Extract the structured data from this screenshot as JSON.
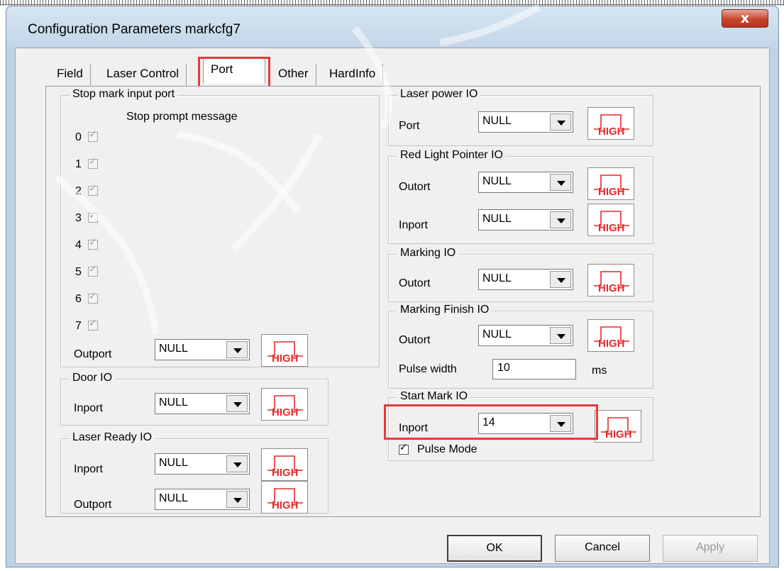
{
  "window": {
    "title": "Configuration Parameters markcfg7",
    "close_glyph": "x"
  },
  "tabs": [
    {
      "label": "Field",
      "active": false
    },
    {
      "label": "Laser Control",
      "active": false
    },
    {
      "label": "Port",
      "active": true
    },
    {
      "label": "Other",
      "active": false
    },
    {
      "label": "HardInfo",
      "active": false
    }
  ],
  "stop_mark": {
    "legend": "Stop mark input port",
    "caption": "Stop prompt message",
    "inputs": [
      {
        "index": "0",
        "checked": true
      },
      {
        "index": "1",
        "checked": true
      },
      {
        "index": "2",
        "checked": true
      },
      {
        "index": "3",
        "checked": true
      },
      {
        "index": "4",
        "checked": true
      },
      {
        "index": "5",
        "checked": true
      },
      {
        "index": "6",
        "checked": true
      },
      {
        "index": "7",
        "checked": true
      }
    ],
    "outport_label": "Outport",
    "outport_value": "NULL"
  },
  "door_io": {
    "legend": "Door IO",
    "inport_label": "Inport",
    "inport_value": "NULL"
  },
  "laser_ready_io": {
    "legend": "Laser Ready IO",
    "inport_label": "Inport",
    "inport_value": "NULL",
    "outport_label": "Outport",
    "outport_value": "NULL"
  },
  "laser_power_io": {
    "legend": "Laser power IO",
    "port_label": "Port",
    "port_value": "NULL"
  },
  "red_light_io": {
    "legend": "Red Light Pointer IO",
    "outport_label": "Outort",
    "outport_value": "NULL",
    "inport_label": "Inport",
    "inport_value": "NULL"
  },
  "marking_io": {
    "legend": "Marking IO",
    "outport_label": "Outort",
    "outport_value": "NULL"
  },
  "marking_finish_io": {
    "legend": "Marking Finish IO",
    "outport_label": "Outort",
    "outport_value": "NULL",
    "pulse_width_label": "Pulse width",
    "pulse_width_value": "10",
    "pulse_width_unit": "ms"
  },
  "start_mark_io": {
    "legend": "Start Mark IO",
    "inport_label": "Inport",
    "inport_value": "14",
    "pulse_mode_label": "Pulse Mode",
    "pulse_mode_checked": true
  },
  "level_button_label": "HIGH",
  "buttons": {
    "ok": "OK",
    "cancel": "Cancel",
    "apply": "Apply"
  },
  "colors": {
    "highlight": "#e53a3a",
    "high_signal": "#e42a2a",
    "title_bar": "#c3d6e8",
    "close_button": "#c9452e"
  },
  "icons": {
    "high_level": "pulse-waveform-icon",
    "close": "close-x-icon",
    "check": "checkmark"
  }
}
